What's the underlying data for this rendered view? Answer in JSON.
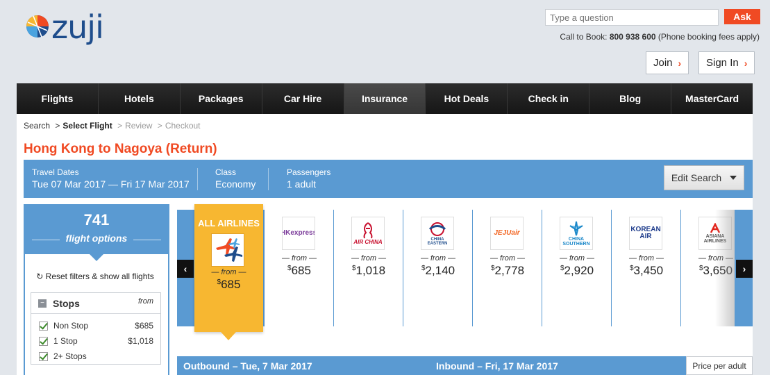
{
  "brand": {
    "name": "zuji"
  },
  "ask": {
    "placeholder": "Type a question",
    "button": "Ask"
  },
  "phone": {
    "prefix": "Call to Book:",
    "number": "800 938 600",
    "suffix": "(Phone booking fees apply)"
  },
  "account": {
    "join": "Join",
    "signin": "Sign In"
  },
  "nav": [
    "Flights",
    "Hotels",
    "Packages",
    "Car Hire",
    "Insurance",
    "Hot Deals",
    "Check in",
    "Blog",
    "MasterCard"
  ],
  "breadcrumb": {
    "search": "Search",
    "select": "Select Flight",
    "review": "Review",
    "checkout": "Checkout"
  },
  "page_title": "Hong Kong to Nagoya (Return)",
  "summary": {
    "dates_label": "Travel Dates",
    "dates_value": "Tue 07 Mar 2017 — Fri 17 Mar 2017",
    "class_label": "Class",
    "class_value": "Economy",
    "pax_label": "Passengers",
    "pax_value": "1 adult",
    "edit": "Edit Search"
  },
  "sidebar": {
    "count": "741",
    "count_label": "flight options",
    "reset": "Reset filters & show all flights",
    "stops": {
      "title": "Stops",
      "from": "from",
      "rows": [
        {
          "label": "Non Stop",
          "price": "$685"
        },
        {
          "label": "1 Stop",
          "price": "$1,018"
        },
        {
          "label": "2+ Stops",
          "price": ""
        }
      ]
    }
  },
  "all_airlines": {
    "label": "ALL AIRLINES",
    "from": "— from —",
    "currency": "$",
    "price": "685"
  },
  "airlines": [
    {
      "logo": "HKexpress",
      "from": "— from —",
      "currency": "$",
      "price": "685"
    },
    {
      "logo": "AIR CHINA",
      "from": "— from —",
      "currency": "$",
      "price": "1,018"
    },
    {
      "logo": "CHINA EASTERN",
      "from": "— from —",
      "currency": "$",
      "price": "2,140"
    },
    {
      "logo": "JEJUair",
      "from": "— from —",
      "currency": "$",
      "price": "2,778"
    },
    {
      "logo": "CHINA SOUTHERN",
      "from": "— from —",
      "currency": "$",
      "price": "2,920"
    },
    {
      "logo": "KOREAN AIR",
      "from": "— from —",
      "currency": "$",
      "price": "3,450"
    },
    {
      "logo": "ASIANA AIRLINES",
      "from": "— from —",
      "currency": "$",
      "price": "3,650"
    }
  ],
  "results_header": {
    "outbound": "Outbound – Tue, 7 Mar 2017",
    "inbound": "Inbound – Fri, 17 Mar 2017",
    "price_per": "Price per adult"
  },
  "colors": {
    "accent": "#f04a23",
    "blue": "#5a9ad2",
    "yellow": "#f7b731",
    "nav": "#1b1b1b"
  }
}
